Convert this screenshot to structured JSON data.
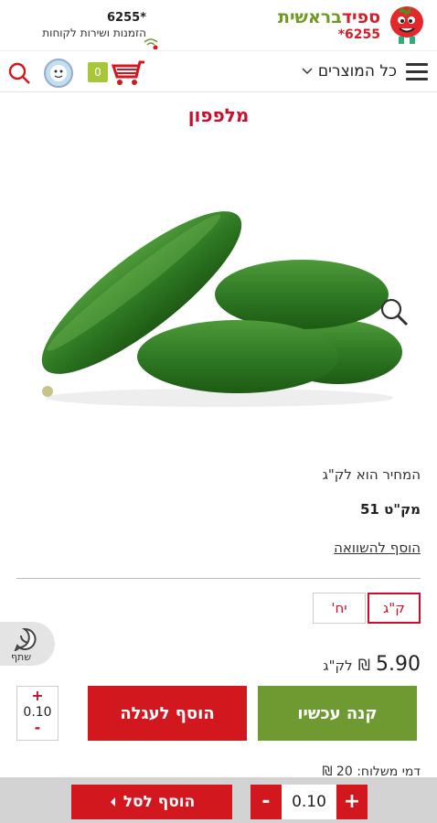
{
  "header": {
    "logo_part1": "ספיד",
    "logo_part2": "בראשית",
    "logo_phone": "*6255",
    "service_phone": "6255*",
    "service_text": "הזמנות ושירות לקוחות"
  },
  "nav": {
    "all_products_label": "כל המוצרים",
    "cart_count": "0"
  },
  "product": {
    "title": "מלפפון",
    "price_note": "המחיר הוא לק\"ג",
    "sku": "מק\"ט 51",
    "compare_label": "הוסף להשוואה",
    "units": [
      {
        "label": "ק\"ג",
        "selected": true
      },
      {
        "label": "יח'",
        "selected": false
      }
    ],
    "price_amount": "5.90",
    "price_currency": "₪",
    "price_unit": "לק\"ג",
    "quantity": "0.10",
    "shipping_peek": "דמי משלוח: 20 ₪"
  },
  "actions": {
    "buy_now_label": "קנה עכשיו",
    "add_to_cart_label": "הוסף לעגלה",
    "plus_symbol": "+",
    "minus_symbol": "-"
  },
  "whatsapp": {
    "label": "שתף"
  },
  "bottom_bar": {
    "add_to_basket_label": "הוסף לסל",
    "quantity": "0.10",
    "plus_symbol": "+",
    "minus_symbol": "-"
  },
  "colors": {
    "brand_red": "#d2171f",
    "brand_green": "#6f9a31",
    "title_red": "#c8102e"
  }
}
